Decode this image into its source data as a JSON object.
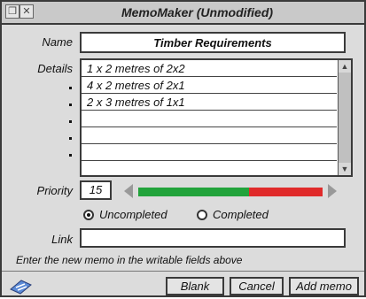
{
  "window": {
    "title": "MemoMaker (Unmodified)"
  },
  "labels": {
    "name": "Name",
    "details": "Details",
    "priority": "Priority",
    "link": "Link"
  },
  "fields": {
    "name_value": "Timber Requirements",
    "priority_value": "15",
    "link_value": ""
  },
  "details": {
    "lines": [
      "1 x 2 metres of 2x2",
      "4 x 2 metres of 2x1",
      "2 x 3 metres of 1x1",
      "",
      "",
      "",
      ""
    ]
  },
  "status": {
    "uncompleted_label": "Uncompleted",
    "completed_label": "Completed",
    "selected": "Uncompleted"
  },
  "message": "Enter the new memo in the writable fields above",
  "buttons": {
    "blank": "Blank",
    "cancel": "Cancel",
    "add": "Add memo"
  },
  "priority_slider": {
    "level_fraction": 0.6,
    "green": "#22a33b",
    "red": "#e02a2a"
  },
  "icons": {
    "toolbox": "memo-toolbox-icon"
  }
}
